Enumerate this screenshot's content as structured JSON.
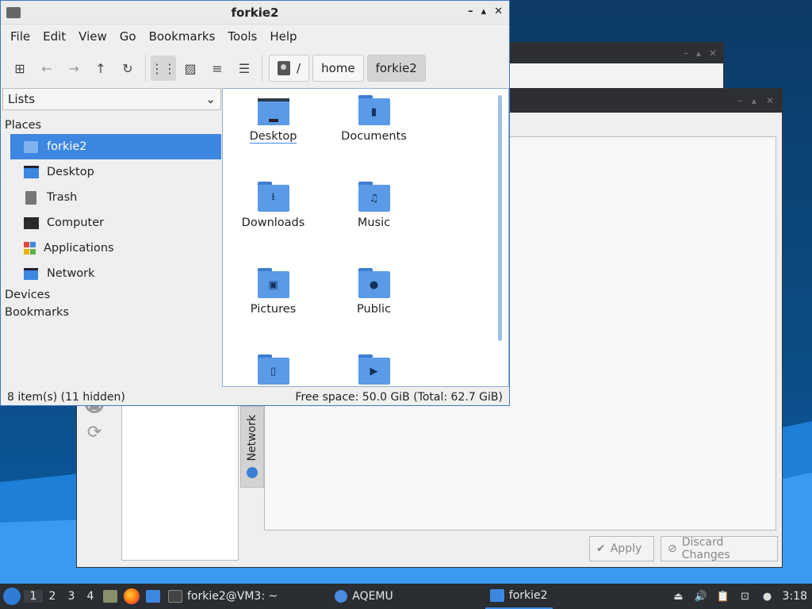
{
  "window": {
    "title": "forkie2",
    "controls": [
      "–",
      "▴",
      "✕"
    ]
  },
  "menubar": [
    "File",
    "Edit",
    "View",
    "Go",
    "Bookmarks",
    "Tools",
    "Help"
  ],
  "breadcrumb": {
    "root": "/",
    "items": [
      "home",
      "forkie2"
    ]
  },
  "sidebar": {
    "selector": "Lists",
    "places_header": "Places",
    "places": [
      {
        "label": "forkie2",
        "icon": "home-icon"
      },
      {
        "label": "Desktop",
        "icon": "desktop-icon"
      },
      {
        "label": "Trash",
        "icon": "trash-icon"
      },
      {
        "label": "Computer",
        "icon": "computer-icon"
      },
      {
        "label": "Applications",
        "icon": "applications-icon"
      },
      {
        "label": "Network",
        "icon": "network-icon"
      }
    ],
    "devices_header": "Devices",
    "bookmarks_header": "Bookmarks"
  },
  "files": [
    {
      "label": "Desktop",
      "glyph": ""
    },
    {
      "label": "Documents",
      "glyph": "▮"
    },
    {
      "label": "Downloads",
      "glyph": "⭳"
    },
    {
      "label": "Music",
      "glyph": "♫"
    },
    {
      "label": "Pictures",
      "glyph": "▣"
    },
    {
      "label": "Public",
      "glyph": "●"
    },
    {
      "label": "",
      "glyph": "▯"
    },
    {
      "label": "",
      "glyph": "▶"
    }
  ],
  "statusbar": {
    "items": "8 item(s) (11 hidden)",
    "space": "Free space: 50.0 GiB (Total: 62.7 GiB)"
  },
  "background_window": {
    "tab_label": "Network",
    "apply_label": "Apply",
    "discard_label": "Discard Changes"
  },
  "taskbar": {
    "workspaces": [
      "1",
      "2",
      "3",
      "4"
    ],
    "tasks": [
      {
        "label": "forkie2@VM3: ~",
        "icon": "terminal-icon"
      },
      {
        "label": "AQEMU",
        "icon": "aqemu-icon"
      },
      {
        "label": "forkie2",
        "icon": "folder-icon"
      }
    ],
    "clock": "3:18"
  }
}
